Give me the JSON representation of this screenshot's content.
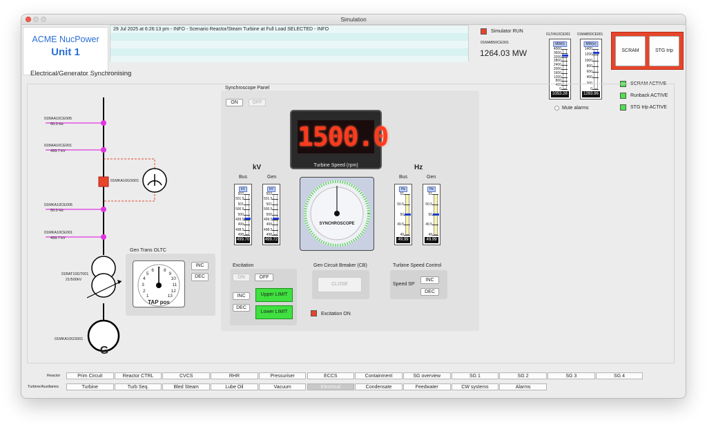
{
  "window": {
    "title": "Simulation"
  },
  "brand": {
    "company": "ACME NucPower",
    "unit": "Unit 1"
  },
  "log": {
    "entries": [
      "29 Jul 2025 at 6:26:13 pm - INFO - Scenario Reactor/Steam Turbine at Full Load SELECTED - INFO"
    ]
  },
  "status": {
    "simulator": "Simulator RUN",
    "power_tag": "01MAB50CE001",
    "power_value": "1264.03 MW"
  },
  "meters_top": [
    {
      "tag": "01JYA10CE001",
      "unit": "MW(t)",
      "readout": "3353.28",
      "level": 0.84,
      "ticks": [
        "4000",
        "3600",
        "3200",
        "2800",
        "2400",
        "2000",
        "1600",
        "1200",
        "800",
        "400",
        "0"
      ]
    },
    {
      "tag": "01MAB50CE001",
      "unit": "MW(e)",
      "readout": "1263.96",
      "level": 0.9,
      "ticks": [
        "1400",
        "1200",
        "1000",
        "800",
        "600",
        "400",
        "200",
        "0"
      ]
    }
  ],
  "protection": {
    "scram": "SCRAM",
    "stg_trip": "STG trip"
  },
  "mute_alarms": "Mute alarms",
  "alarms": [
    "SCRAM ACTIVE",
    "Runback ACTIVE",
    "STG trip ACTIVE"
  ],
  "section_title": "Electrical/Generator Synchronising",
  "sld": {
    "tags": [
      {
        "tag": "01BAA10CE005",
        "value": "50.0 Hz"
      },
      {
        "tag": "01BAA10CE001",
        "value": "499.7 kV"
      },
      {
        "tag": "01MKA10CE005",
        "value": "50.0 Hz"
      },
      {
        "tag": "01MKA10CE001",
        "value": "499.7 kV"
      }
    ],
    "breaker_tag": "01MKA10GS001",
    "transformer_tag": "01BAT10GT001",
    "transformer_rating": "21/500kV",
    "generator_tag": "01MKA10GS001",
    "generator_symbol": "G"
  },
  "oltc": {
    "title": "Gen Trans OLTC",
    "inc": "INC",
    "dec": "DEC",
    "label": "TAP pos",
    "dial_numbers": [
      "1",
      "2",
      "3",
      "4",
      "5",
      "6",
      "7",
      "8",
      "9",
      "10",
      "11",
      "12",
      "13"
    ]
  },
  "sync": {
    "title": "Synchroscope Panel",
    "on": "ON",
    "off": "OFF",
    "speed_display": "1500.0",
    "speed_label": "Turbine Speed (rpm)",
    "kv_heading": "kV",
    "hz_heading": "Hz",
    "synchroscope_label": "SYNCHROSCOPE",
    "kv_meters": [
      {
        "name": "Bus",
        "unit": "kV",
        "readout": "499.70",
        "level": 0.4,
        "ticks": [
          "502",
          "501.5",
          "501",
          "500.5",
          "500",
          "499.5",
          "499",
          "498.5",
          "498"
        ]
      },
      {
        "name": "Gen",
        "unit": "kV",
        "readout": "499.72",
        "level": 0.4,
        "ticks": [
          "502",
          "501.5",
          "501",
          "500.5",
          "500",
          "499.5",
          "499",
          "498.5",
          "498"
        ]
      }
    ],
    "hz_meters": [
      {
        "name": "Bus",
        "unit": "Hz",
        "readout": "49.99",
        "level": 0.5,
        "ticks": [
          "51",
          "50.5",
          "50",
          "49.5",
          "49"
        ]
      },
      {
        "name": "Gen",
        "unit": "Hz",
        "readout": "49.99",
        "level": 0.5,
        "ticks": [
          "51",
          "50.5",
          "50",
          "49.5",
          "49"
        ]
      }
    ],
    "excitation": {
      "title": "Excitation",
      "on": "ON",
      "off": "OFF",
      "inc": "INC",
      "dec": "DEC",
      "upper": "Upper LIMIT",
      "lower": "Lower LIMIT",
      "status": "Excitation ON"
    },
    "gcb": {
      "title": "Gen Circuit Breaker (CB)",
      "close": "CLOSE"
    },
    "speed_control": {
      "title": "Turbine Speed Control",
      "label": "Speed SP",
      "inc": "INC",
      "dec": "DEC"
    }
  },
  "nav": {
    "reactor_label": "Reactor",
    "turbine_label": "Turbine/Auxiliaries",
    "reactor": [
      "Prim Circuit",
      "Reactor CTRL",
      "CVCS",
      "RHR",
      "Pressuriser",
      "ECCS",
      "Containment",
      "SG overview",
      "SG 1",
      "SG 2",
      "SG 3",
      "SG 4"
    ],
    "turbine": [
      "Turbine",
      "Turb Seq.",
      "Bled Steam",
      "Lube Oil",
      "Vacuum",
      "Electrical",
      "Condensate",
      "Feedwater",
      "CW systems",
      "Alarms"
    ],
    "turbine_selected": "Electrical"
  }
}
